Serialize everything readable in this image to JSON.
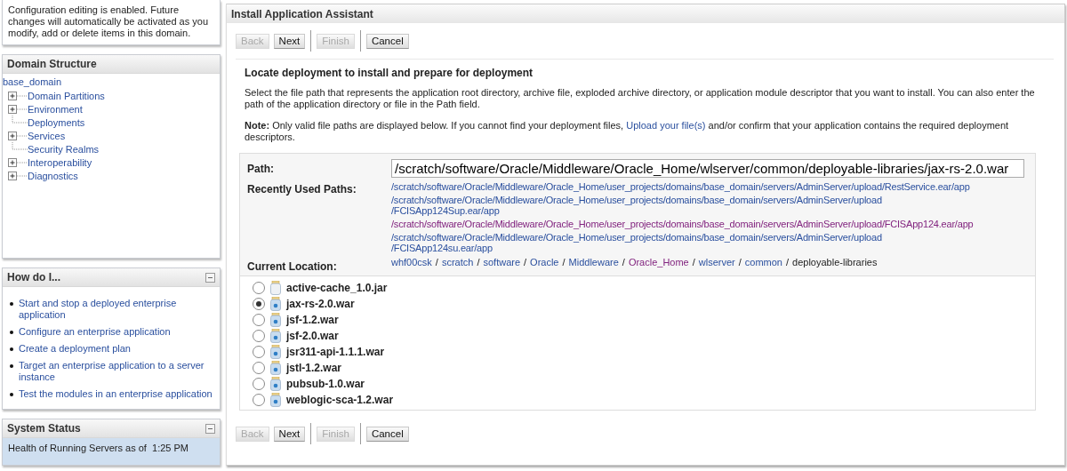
{
  "change_center": {
    "message": "Configuration editing is enabled. Future changes will automatically be activated as you modify, add or delete items in this domain."
  },
  "domain_structure": {
    "title": "Domain Structure",
    "root": "base_domain",
    "items": [
      {
        "label": "Domain Partitions",
        "kind": "branch"
      },
      {
        "label": "Environment",
        "kind": "branch"
      },
      {
        "label": "Deployments",
        "kind": "leaf"
      },
      {
        "label": "Services",
        "kind": "branch"
      },
      {
        "label": "Security Realms",
        "kind": "leaf"
      },
      {
        "label": "Interoperability",
        "kind": "branch"
      },
      {
        "label": "Diagnostics",
        "kind": "branch"
      }
    ]
  },
  "how_do_i": {
    "title": "How do I...",
    "expanded": true,
    "links": [
      "Start and stop a deployed enterprise application",
      "Configure an enterprise application",
      "Create a deployment plan",
      "Target an enterprise application to a server instance",
      "Test the modules in an enterprise application"
    ]
  },
  "system_status": {
    "title": "System Status",
    "expanded": true,
    "text": "Health of Running Servers as of  1:25 PM"
  },
  "assistant": {
    "title": "Install Application Assistant",
    "top_buttons": [
      {
        "label": "Back",
        "disabled": true
      },
      {
        "label": "Next",
        "disabled": false
      },
      {
        "label": "Finish",
        "disabled": true
      },
      {
        "label": "Cancel",
        "disabled": false
      }
    ],
    "bottom_buttons": [
      {
        "label": "Back",
        "disabled": true
      },
      {
        "label": "Next",
        "disabled": false
      },
      {
        "label": "Finish",
        "disabled": true
      },
      {
        "label": "Cancel",
        "disabled": false
      }
    ],
    "heading": "Locate deployment to install and prepare for deployment",
    "description": "Select the file path that represents the application root directory, archive file, exploded archive directory, or application module descriptor that you want to install. You can also enter the path of the application directory or file in the Path field.",
    "note_before": "**Note:** Only valid file paths are displayed below. If you cannot find your deployment files,",
    "note_link": "Upload your file(s)",
    "note_after": "and/or confirm that your application contains the required deployment descriptors.",
    "path": {
      "label": "Path:",
      "value": "/scratch/software/Oracle/Middleware/Oracle_Home/wlserver/common/deployable-libraries/jax-rs-2.0.war"
    },
    "recent": {
      "label": "Recently Used Paths:",
      "paths": [
        {
          "lines": [
            "/scratch/software/Oracle/Middleware/Oracle_Home/user_projects/domains/base_domain/servers/AdminServer/upload/RestService.ear/app"
          ],
          "visited": false
        },
        {
          "lines": [
            "/scratch/software/Oracle/Middleware/Oracle_Home/user_projects/domains/base_domain/servers/AdminServer/upload",
            "/FCISApp124Sup.ear/app"
          ],
          "visited": false
        },
        {
          "lines": [
            "/scratch/software/Oracle/Middleware/Oracle_Home/user_projects/domains/base_domain/servers/AdminServer/upload/FCISApp124.ear/app"
          ],
          "visited": true
        },
        {
          "lines": [
            "/scratch/software/Oracle/Middleware/Oracle_Home/user_projects/domains/base_domain/servers/AdminServer/upload",
            "/FCISApp124su.ear/app"
          ],
          "visited": false
        }
      ]
    },
    "location": {
      "label": "Current Location:",
      "crumbs": [
        {
          "text": "whf00csk",
          "kind": "link"
        },
        {
          "text": "scratch",
          "kind": "link"
        },
        {
          "text": "software",
          "kind": "link"
        },
        {
          "text": "Oracle",
          "kind": "link"
        },
        {
          "text": "Middleware",
          "kind": "link"
        },
        {
          "text": "Oracle_Home",
          "kind": "visited"
        },
        {
          "text": "wlserver",
          "kind": "link"
        },
        {
          "text": "common",
          "kind": "link"
        },
        {
          "text": "deployable-libraries",
          "kind": "current"
        }
      ],
      "separator": "/"
    },
    "files": [
      {
        "name": "active-cache_1.0.jar",
        "kind": "jar",
        "selected": false
      },
      {
        "name": "jax-rs-2.0.war",
        "kind": "war",
        "selected": true
      },
      {
        "name": "jsf-1.2.war",
        "kind": "war",
        "selected": false
      },
      {
        "name": "jsf-2.0.war",
        "kind": "war",
        "selected": false
      },
      {
        "name": "jsr311-api-1.1.1.war",
        "kind": "war",
        "selected": false
      },
      {
        "name": "jstl-1.2.war",
        "kind": "war",
        "selected": false
      },
      {
        "name": "pubsub-1.0.war",
        "kind": "war",
        "selected": false
      },
      {
        "name": "weblogic-sca-1.2.war",
        "kind": "war",
        "selected": false
      }
    ]
  }
}
